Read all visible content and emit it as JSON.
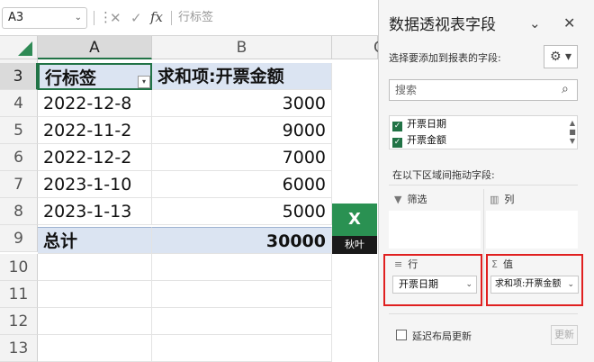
{
  "formula_bar": {
    "name_box": "A3",
    "cancel_icon": "✕",
    "enter_icon": "✓",
    "fx_label": "fx",
    "formula": "行标签"
  },
  "columns": [
    "A",
    "B",
    "C"
  ],
  "rows": [
    {
      "num": "3",
      "a": "行标签",
      "b": "求和项:开票金额"
    },
    {
      "num": "4",
      "a": "2022-12-8",
      "b": "3000"
    },
    {
      "num": "5",
      "a": "2022-11-2",
      "b": "9000"
    },
    {
      "num": "6",
      "a": "2022-12-2",
      "b": "7000"
    },
    {
      "num": "7",
      "a": "2023-1-10",
      "b": "6000"
    },
    {
      "num": "8",
      "a": "2023-1-13",
      "b": "5000"
    },
    {
      "num": "9",
      "a": "总计",
      "b": "30000"
    },
    {
      "num": "10",
      "a": "",
      "b": ""
    },
    {
      "num": "11",
      "a": "",
      "b": ""
    },
    {
      "num": "12",
      "a": "",
      "b": ""
    },
    {
      "num": "13",
      "a": "",
      "b": ""
    }
  ],
  "logo": {
    "top": "X",
    "bottom": "秋叶"
  },
  "pivot_pane": {
    "title": "数据透视表字段",
    "subtitle": "选择要添加到报表的字段:",
    "search_placeholder": "搜索",
    "fields": [
      {
        "label": "开票日期",
        "checked": true
      },
      {
        "label": "开票金额",
        "checked": true
      }
    ],
    "drag_tip": "在以下区域间拖动字段:",
    "areas": {
      "filter": "筛选",
      "columns": "列",
      "rows": "行",
      "values": "值"
    },
    "rows_field": "开票日期",
    "values_field": "求和项:开票金额",
    "defer_label": "延迟布局更新",
    "update_label": "更新"
  },
  "colors": {
    "accent": "#217346",
    "highlight": "#e02020",
    "pivot_header": "#dbe4f2"
  }
}
